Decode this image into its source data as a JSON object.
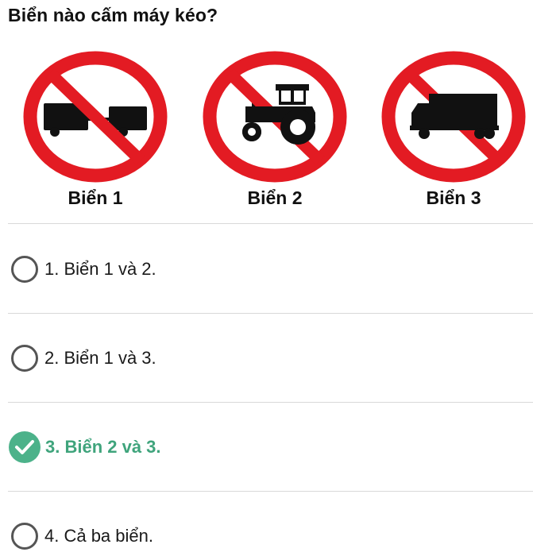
{
  "question": {
    "text": "Biển nào cấm máy kéo?"
  },
  "signs": [
    {
      "label": "Biển 1",
      "icon": "no-trailer-icon"
    },
    {
      "label": "Biển 2",
      "icon": "no-tractor-icon"
    },
    {
      "label": "Biển 3",
      "icon": "no-truck-icon"
    }
  ],
  "options": [
    {
      "text": "1. Biển 1 và 2.",
      "selected": false
    },
    {
      "text": "2. Biển 1 và 3.",
      "selected": false
    },
    {
      "text": "3. Biển 2 và 3.",
      "selected": true
    },
    {
      "text": "4. Cả ba biển.",
      "selected": false
    }
  ],
  "colors": {
    "sign_red": "#e31b23",
    "correct_green": "#4cb28a",
    "correct_text": "#3fa47c",
    "divider": "#d9d9d9"
  }
}
